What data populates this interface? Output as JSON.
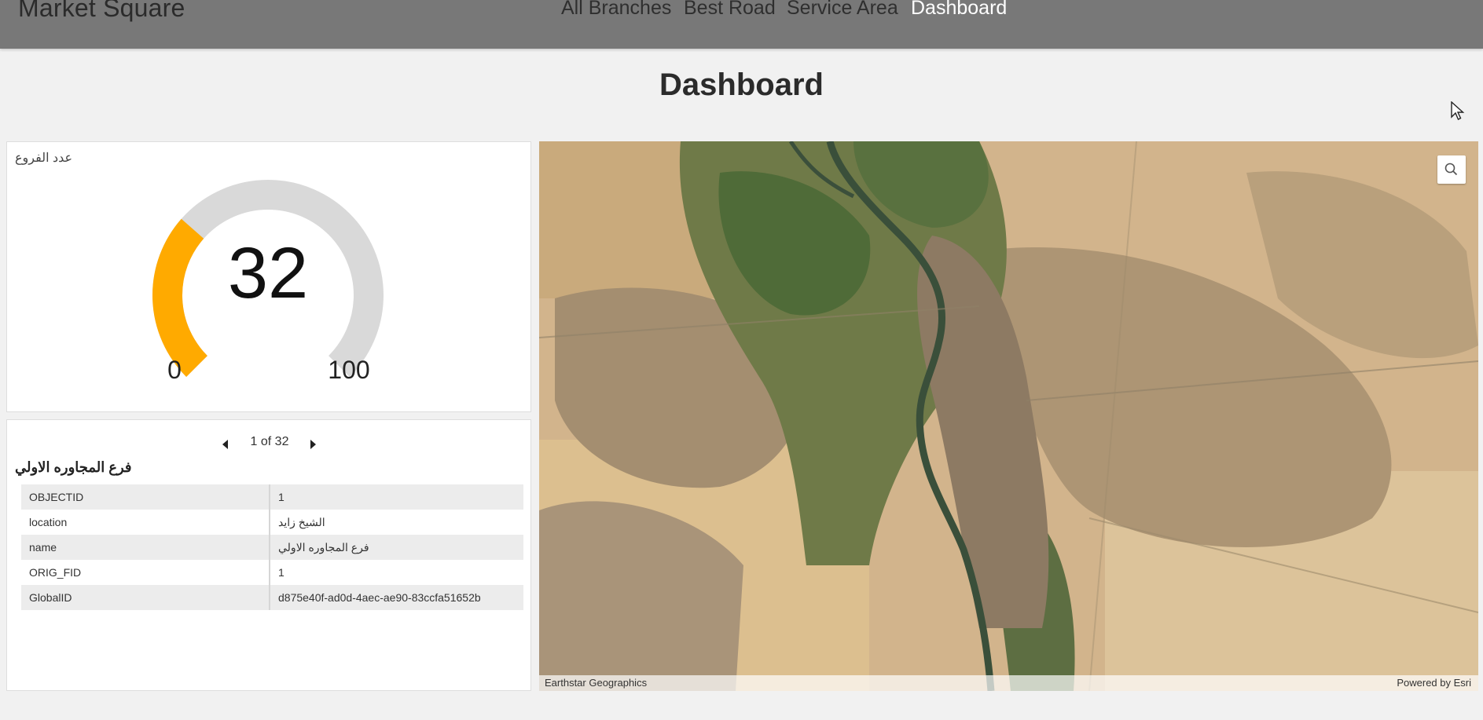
{
  "app": {
    "brand": "Market Square"
  },
  "nav": {
    "items": [
      {
        "label": "All Branches",
        "active": false
      },
      {
        "label": "Best Road",
        "active": false
      },
      {
        "label": "Service Area",
        "active": false
      },
      {
        "label": "Dashboard",
        "active": true
      }
    ]
  },
  "page": {
    "title": "Dashboard"
  },
  "gauge": {
    "title": "عدد الفروع",
    "value": "32",
    "min_label": "0",
    "max_label": "100",
    "value_num": 32,
    "min": 0,
    "max": 100,
    "fill_color": "#ffaa00",
    "track_color": "#d9d9d9"
  },
  "details": {
    "pager": "1 of 32",
    "feature_title": "فرع المجاوره الاولي",
    "attributes": [
      {
        "key": "OBJECTID",
        "value": "1"
      },
      {
        "key": "location",
        "value": "الشيخ زايد"
      },
      {
        "key": "name",
        "value": "فرع المجاوره الاولي"
      },
      {
        "key": "ORIG_FID",
        "value": "1"
      },
      {
        "key": "GlobalID",
        "value": "d875e40f-ad0d-4aec-ae90-83ccfa51652b"
      }
    ]
  },
  "map": {
    "attribution_left": "Earthstar Geographics",
    "attribution_right": "Powered by Esri",
    "search_icon": "search-icon"
  },
  "colors": {
    "topbar": "#787878",
    "active_nav": "#ffffff",
    "gauge_fill": "#ffaa00"
  }
}
